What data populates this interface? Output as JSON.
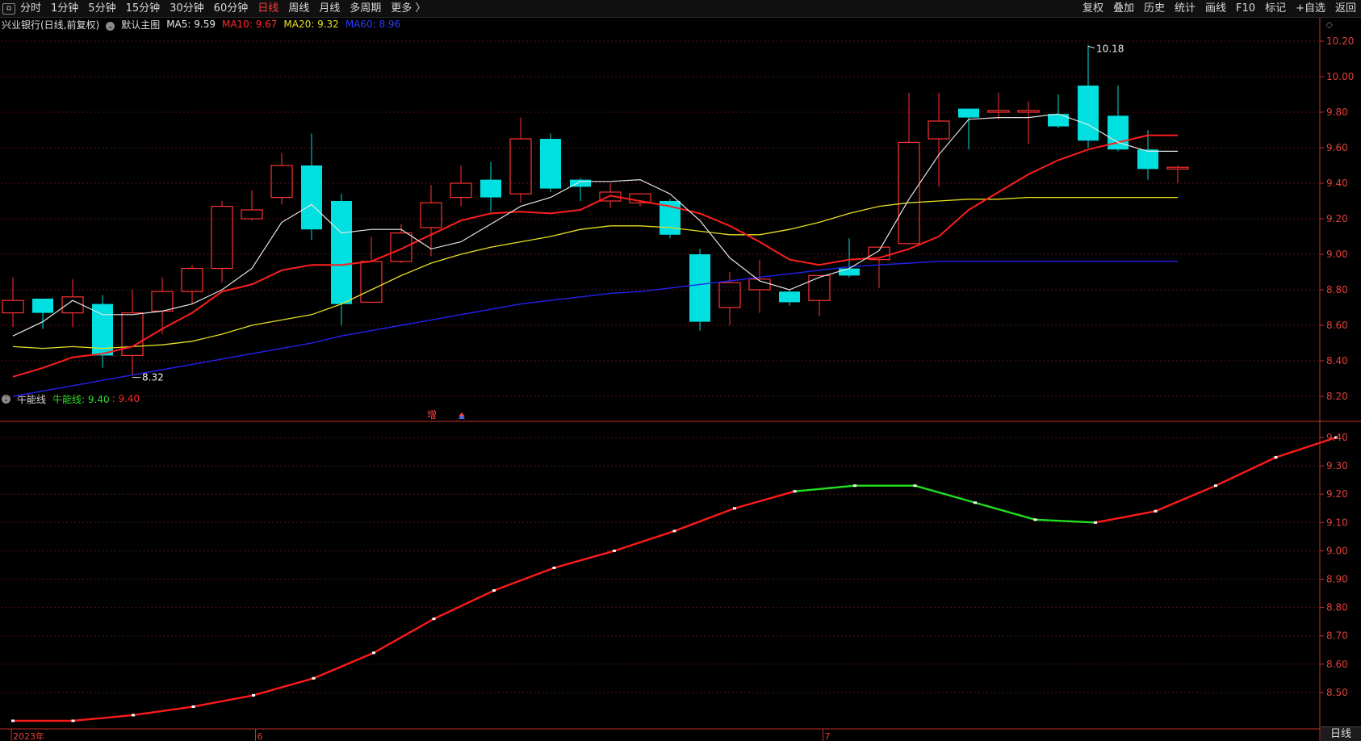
{
  "toolbar": {
    "left": [
      "分时",
      "1分钟",
      "5分钟",
      "15分钟",
      "30分钟",
      "60分钟",
      "日线",
      "周线",
      "月线",
      "多周期",
      "更多 〉"
    ],
    "active": "日线",
    "right": [
      "复权",
      "叠加",
      "历史",
      "统计",
      "画线",
      "F10",
      "标记",
      "+自选",
      "返回"
    ]
  },
  "main_info": {
    "name": "兴业银行(日线,前复权)",
    "template": "默认主图",
    "ma5": "MA5: 9.59",
    "ma10": "MA10: 9.67",
    "ma20": "MA20: 9.32",
    "ma60": "MA60: 8.96"
  },
  "sub_info": {
    "name": "牛能线",
    "value_label": "牛能线: 9.40",
    "value2": ": 9.40"
  },
  "markers": {
    "high": "10.18",
    "low": "8.32",
    "zeng": "增"
  },
  "colors": {
    "up": "#ff3232",
    "down": "#00e0e0",
    "ma5": "#e6e6e6",
    "ma10": "#ff1e1e",
    "ma20": "#e8e022",
    "ma60": "#2222ee",
    "bull_up": "#ff1a1a",
    "bull_down": "#20e020",
    "axis": "#c0302a"
  },
  "date_labels": [
    "2023年",
    "6",
    "7"
  ],
  "bottom_tab": "日线",
  "chart_data": [
    {
      "type": "candlestick",
      "title": "兴业银行(日线,前复权)",
      "ylim": [
        8.15,
        10.25
      ],
      "y_ticks": [
        8.2,
        8.4,
        8.6,
        8.8,
        9.0,
        9.2,
        9.4,
        9.6,
        9.8,
        10.0,
        10.2
      ],
      "candles": [
        {
          "o": 8.67,
          "h": 8.87,
          "l": 8.59,
          "c": 8.74
        },
        {
          "o": 8.75,
          "h": 8.75,
          "l": 8.58,
          "c": 8.67
        },
        {
          "o": 8.67,
          "h": 8.86,
          "l": 8.59,
          "c": 8.76
        },
        {
          "o": 8.72,
          "h": 8.77,
          "l": 8.36,
          "c": 8.43
        },
        {
          "o": 8.43,
          "h": 8.8,
          "l": 8.32,
          "c": 8.67
        },
        {
          "o": 8.68,
          "h": 8.87,
          "l": 8.55,
          "c": 8.79
        },
        {
          "o": 8.79,
          "h": 8.94,
          "l": 8.72,
          "c": 8.92
        },
        {
          "o": 8.92,
          "h": 9.3,
          "l": 8.84,
          "c": 9.27
        },
        {
          "o": 9.2,
          "h": 9.36,
          "l": 9.19,
          "c": 9.25
        },
        {
          "o": 9.32,
          "h": 9.57,
          "l": 9.28,
          "c": 9.5
        },
        {
          "o": 9.5,
          "h": 9.68,
          "l": 9.08,
          "c": 9.14
        },
        {
          "o": 9.3,
          "h": 9.34,
          "l": 8.6,
          "c": 8.72
        },
        {
          "o": 8.73,
          "h": 9.1,
          "l": 8.73,
          "c": 8.96
        },
        {
          "o": 8.96,
          "h": 9.17,
          "l": 8.95,
          "c": 9.12
        },
        {
          "o": 9.15,
          "h": 9.39,
          "l": 8.99,
          "c": 9.29
        },
        {
          "o": 9.32,
          "h": 9.5,
          "l": 9.27,
          "c": 9.4
        },
        {
          "o": 9.42,
          "h": 9.52,
          "l": 9.24,
          "c": 9.32
        },
        {
          "o": 9.34,
          "h": 9.77,
          "l": 9.29,
          "c": 9.65
        },
        {
          "o": 9.65,
          "h": 9.68,
          "l": 9.35,
          "c": 9.37
        },
        {
          "o": 9.42,
          "h": 9.43,
          "l": 9.3,
          "c": 9.38
        },
        {
          "o": 9.3,
          "h": 9.4,
          "l": 9.26,
          "c": 9.35
        },
        {
          "o": 9.29,
          "h": 9.34,
          "l": 9.27,
          "c": 9.34
        },
        {
          "o": 9.3,
          "h": 9.31,
          "l": 9.09,
          "c": 9.11
        },
        {
          "o": 9.0,
          "h": 9.03,
          "l": 8.57,
          "c": 8.62
        },
        {
          "o": 8.7,
          "h": 8.9,
          "l": 8.6,
          "c": 8.84
        },
        {
          "o": 8.8,
          "h": 8.97,
          "l": 8.67,
          "c": 8.86
        },
        {
          "o": 8.79,
          "h": 8.8,
          "l": 8.71,
          "c": 8.73
        },
        {
          "o": 8.74,
          "h": 8.88,
          "l": 8.65,
          "c": 8.88
        },
        {
          "o": 8.92,
          "h": 9.09,
          "l": 8.87,
          "c": 8.88
        },
        {
          "o": 8.97,
          "h": 9.04,
          "l": 8.81,
          "c": 9.04
        },
        {
          "o": 9.06,
          "h": 9.91,
          "l": 9.06,
          "c": 9.63
        },
        {
          "o": 9.65,
          "h": 9.91,
          "l": 9.38,
          "c": 9.75
        },
        {
          "o": 9.82,
          "h": 9.82,
          "l": 9.59,
          "c": 9.77
        },
        {
          "o": 9.8,
          "h": 9.91,
          "l": 9.76,
          "c": 9.81
        },
        {
          "o": 9.8,
          "h": 9.86,
          "l": 9.62,
          "c": 9.81
        },
        {
          "o": 9.79,
          "h": 9.9,
          "l": 9.71,
          "c": 9.72
        },
        {
          "o": 9.95,
          "h": 10.18,
          "l": 9.6,
          "c": 9.64
        },
        {
          "o": 9.78,
          "h": 9.95,
          "l": 9.58,
          "c": 9.59
        },
        {
          "o": 9.59,
          "h": 9.7,
          "l": 9.42,
          "c": 9.48
        },
        {
          "o": 9.48,
          "h": 9.5,
          "l": 9.4,
          "c": 9.49
        }
      ],
      "ma5": [
        8.54,
        8.62,
        8.74,
        8.66,
        8.66,
        8.68,
        8.72,
        8.8,
        8.92,
        9.18,
        9.28,
        9.12,
        9.14,
        9.14,
        9.03,
        9.07,
        9.17,
        9.27,
        9.32,
        9.41,
        9.41,
        9.42,
        9.34,
        9.19,
        8.98,
        8.85,
        8.8,
        8.87,
        8.92,
        9.02,
        9.31,
        9.56,
        9.76,
        9.77,
        9.77,
        9.79,
        9.73,
        9.63,
        9.58
      ],
      "ma10": [
        8.31,
        8.36,
        8.42,
        8.44,
        8.48,
        8.58,
        8.67,
        8.79,
        8.83,
        8.91,
        8.94,
        8.94,
        8.96,
        9.03,
        9.11,
        9.19,
        9.23,
        9.24,
        9.23,
        9.25,
        9.33,
        9.3,
        9.27,
        9.23,
        9.16,
        9.07,
        8.97,
        8.94,
        8.97,
        8.98,
        9.03,
        9.1,
        9.25,
        9.35,
        9.45,
        9.53,
        9.59,
        9.63,
        9.67
      ],
      "ma20": [
        8.48,
        8.47,
        8.48,
        8.47,
        8.48,
        8.49,
        8.51,
        8.55,
        8.6,
        8.63,
        8.66,
        8.72,
        8.8,
        8.88,
        8.95,
        9.0,
        9.04,
        9.07,
        9.1,
        9.14,
        9.16,
        9.16,
        9.15,
        9.13,
        9.11,
        9.11,
        9.14,
        9.18,
        9.23,
        9.27,
        9.29,
        9.3,
        9.31,
        9.31,
        9.32
      ],
      "ma60": [
        8.2,
        8.23,
        8.26,
        8.29,
        8.32,
        8.35,
        8.38,
        8.41,
        8.44,
        8.47,
        8.5,
        8.54,
        8.57,
        8.6,
        8.63,
        8.66,
        8.69,
        8.72,
        8.74,
        8.76,
        8.78,
        8.79,
        8.81,
        8.83,
        8.85,
        8.87,
        8.89,
        8.91,
        8.93,
        8.94,
        8.95,
        8.96,
        8.96,
        8.96,
        8.96,
        8.96
      ]
    },
    {
      "type": "line",
      "title": "牛能线",
      "ylim": [
        8.38,
        9.44
      ],
      "y_ticks": [
        8.5,
        8.6,
        8.7,
        8.8,
        8.9,
        9.0,
        9.1,
        9.2,
        9.3,
        9.4
      ],
      "values": [
        8.4,
        8.4,
        8.42,
        8.45,
        8.49,
        8.55,
        8.64,
        8.76,
        8.86,
        8.94,
        9.0,
        9.07,
        9.15,
        9.21,
        9.23,
        9.23,
        9.17,
        9.11,
        9.1,
        9.14,
        9.23,
        9.33,
        9.4
      ],
      "down_segments": [
        [
          13,
          18
        ]
      ]
    }
  ]
}
